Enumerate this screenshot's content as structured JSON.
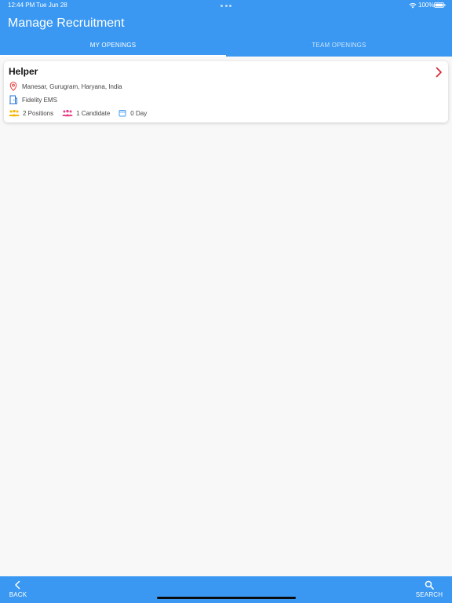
{
  "status_bar": {
    "time": "12:44 PM",
    "date": "Tue Jun 28",
    "battery": "100%"
  },
  "header": {
    "title": "Manage Recruitment"
  },
  "tabs": [
    {
      "label": "MY OPENINGS",
      "active": true
    },
    {
      "label": "TEAM OPENINGS",
      "active": false
    }
  ],
  "openings": [
    {
      "title": "Helper",
      "location": "Manesar, Gurugram, Haryana, India",
      "company": "Fidelity EMS",
      "positions": "2 Positions",
      "candidates": "1 Candidate",
      "days": "0 Day"
    }
  ],
  "bottom_nav": {
    "back_label": "BACK",
    "search_label": "SEARCH"
  },
  "colors": {
    "primary": "#3a98f2",
    "chevron": "#d9232e",
    "location_icon": "#e53935",
    "company_icon": "#1e6fd9",
    "positions_icon": "#f5b400",
    "candidates_icon": "#e83e8c",
    "days_icon": "#3a98f2"
  }
}
